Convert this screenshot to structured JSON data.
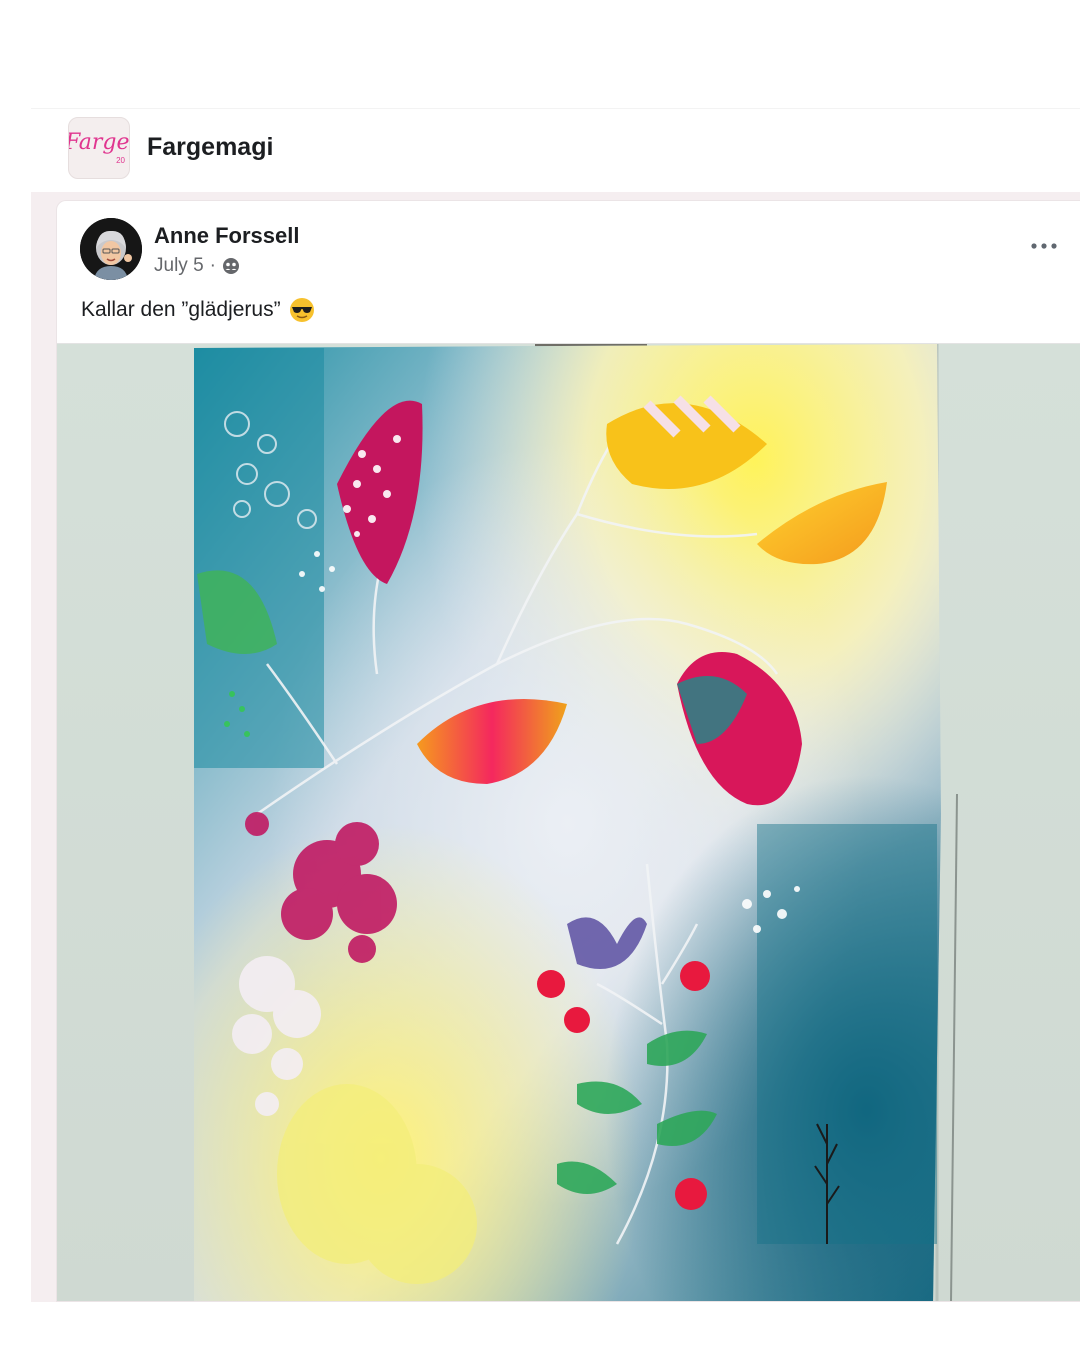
{
  "group": {
    "name": "Fargemagi",
    "logo_text": "Fargem",
    "logo_subtext": "20"
  },
  "post": {
    "author": "Anne Forssell",
    "date": "July 5",
    "separator": "·",
    "text": "Kallar den ”glädjerus”",
    "emoji": "smiling-face-with-sunglasses",
    "photo_subject": "painting"
  },
  "colors": {
    "brand_pink": "#e0358f",
    "feed_background": "#f5eef0",
    "text_primary": "#1c1e21",
    "text_secondary": "#65676b"
  }
}
